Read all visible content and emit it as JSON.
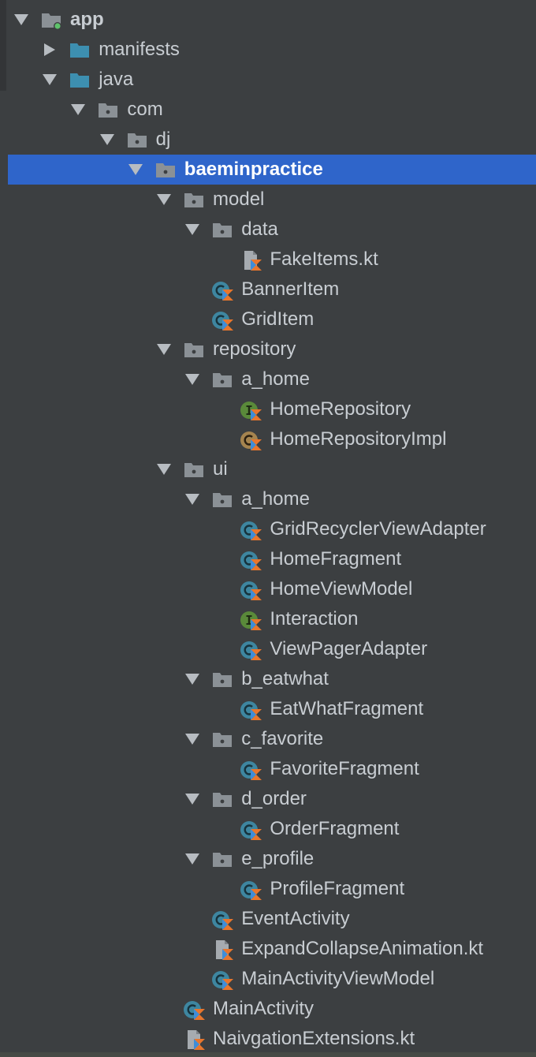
{
  "tree": [
    {
      "label": "app",
      "depth": 0,
      "icon": "module-folder-icon",
      "arrow": "expanded",
      "bold": true
    },
    {
      "label": "manifests",
      "depth": 1,
      "icon": "source-folder-icon",
      "arrow": "collapsed"
    },
    {
      "label": "java",
      "depth": 1,
      "icon": "source-folder-icon",
      "arrow": "expanded"
    },
    {
      "label": "com",
      "depth": 2,
      "icon": "package-icon",
      "arrow": "expanded"
    },
    {
      "label": "dj",
      "depth": 3,
      "icon": "package-icon",
      "arrow": "expanded"
    },
    {
      "label": "baeminpractice",
      "depth": 4,
      "icon": "package-icon",
      "arrow": "expanded",
      "selected": true
    },
    {
      "label": "model",
      "depth": 5,
      "icon": "package-icon",
      "arrow": "expanded"
    },
    {
      "label": "data",
      "depth": 6,
      "icon": "package-icon",
      "arrow": "expanded"
    },
    {
      "label": "FakeItems.kt",
      "depth": 7,
      "icon": "kotlin-file-icon",
      "arrow": "none"
    },
    {
      "label": "BannerItem",
      "depth": 6,
      "icon": "kotlin-class-icon",
      "arrow": "none"
    },
    {
      "label": "GridItem",
      "depth": 6,
      "icon": "kotlin-class-icon",
      "arrow": "none"
    },
    {
      "label": "repository",
      "depth": 5,
      "icon": "package-icon",
      "arrow": "expanded"
    },
    {
      "label": "a_home",
      "depth": 6,
      "icon": "package-icon",
      "arrow": "expanded"
    },
    {
      "label": "HomeRepository",
      "depth": 7,
      "icon": "kotlin-interface-icon",
      "arrow": "none"
    },
    {
      "label": "HomeRepositoryImpl",
      "depth": 7,
      "icon": "kotlin-class-impl-icon",
      "arrow": "none"
    },
    {
      "label": "ui",
      "depth": 5,
      "icon": "package-icon",
      "arrow": "expanded"
    },
    {
      "label": "a_home",
      "depth": 6,
      "icon": "package-icon",
      "arrow": "expanded"
    },
    {
      "label": "GridRecyclerViewAdapter",
      "depth": 7,
      "icon": "kotlin-class-icon",
      "arrow": "none"
    },
    {
      "label": "HomeFragment",
      "depth": 7,
      "icon": "kotlin-class-icon",
      "arrow": "none"
    },
    {
      "label": "HomeViewModel",
      "depth": 7,
      "icon": "kotlin-class-icon",
      "arrow": "none"
    },
    {
      "label": "Interaction",
      "depth": 7,
      "icon": "kotlin-interface-icon",
      "arrow": "none"
    },
    {
      "label": "ViewPagerAdapter",
      "depth": 7,
      "icon": "kotlin-class-icon",
      "arrow": "none"
    },
    {
      "label": "b_eatwhat",
      "depth": 6,
      "icon": "package-icon",
      "arrow": "expanded"
    },
    {
      "label": "EatWhatFragment",
      "depth": 7,
      "icon": "kotlin-class-icon",
      "arrow": "none"
    },
    {
      "label": "c_favorite",
      "depth": 6,
      "icon": "package-icon",
      "arrow": "expanded"
    },
    {
      "label": "FavoriteFragment",
      "depth": 7,
      "icon": "kotlin-class-icon",
      "arrow": "none"
    },
    {
      "label": "d_order",
      "depth": 6,
      "icon": "package-icon",
      "arrow": "expanded"
    },
    {
      "label": "OrderFragment",
      "depth": 7,
      "icon": "kotlin-class-icon",
      "arrow": "none"
    },
    {
      "label": "e_profile",
      "depth": 6,
      "icon": "package-icon",
      "arrow": "expanded"
    },
    {
      "label": "ProfileFragment",
      "depth": 7,
      "icon": "kotlin-class-icon",
      "arrow": "none"
    },
    {
      "label": "EventActivity",
      "depth": 6,
      "icon": "kotlin-class-icon",
      "arrow": "none"
    },
    {
      "label": "ExpandCollapseAnimation.kt",
      "depth": 6,
      "icon": "kotlin-file-icon",
      "arrow": "none"
    },
    {
      "label": "MainActivityViewModel",
      "depth": 6,
      "icon": "kotlin-class-icon",
      "arrow": "none"
    },
    {
      "label": "MainActivity",
      "depth": 5,
      "icon": "kotlin-class-icon",
      "arrow": "none"
    },
    {
      "label": "NaivgationExtensions.kt",
      "depth": 5,
      "icon": "kotlin-file-icon",
      "arrow": "none"
    }
  ],
  "colors": {
    "background": "#3c3f41",
    "selection": "#2f65ca",
    "text": "#c8cdd2",
    "folder": "#8b9196",
    "source_folder": "#3d8fb0",
    "class_circle": "#3e86a0",
    "interface_circle": "#5a8a3a",
    "impl_circle": "#a5844f",
    "kotlin_orange": "#e8762d",
    "kotlin_blue": "#3f8dd8"
  }
}
